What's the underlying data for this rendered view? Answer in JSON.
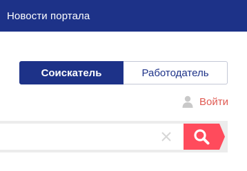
{
  "header": {
    "title": "Новости портала"
  },
  "role_switch": {
    "options": [
      {
        "label": "Соискатель",
        "selected": true
      },
      {
        "label": "Работодатель",
        "selected": false
      }
    ]
  },
  "login": {
    "label": "Войти",
    "icon": "user-icon"
  },
  "search": {
    "value": "",
    "placeholder": "",
    "clear_icon": "close-icon",
    "button_icon": "search-icon"
  },
  "colors": {
    "primary": "#1d3288",
    "accent": "#ff4b5c",
    "login_text": "#e05a52",
    "search_track": "#ececec"
  }
}
